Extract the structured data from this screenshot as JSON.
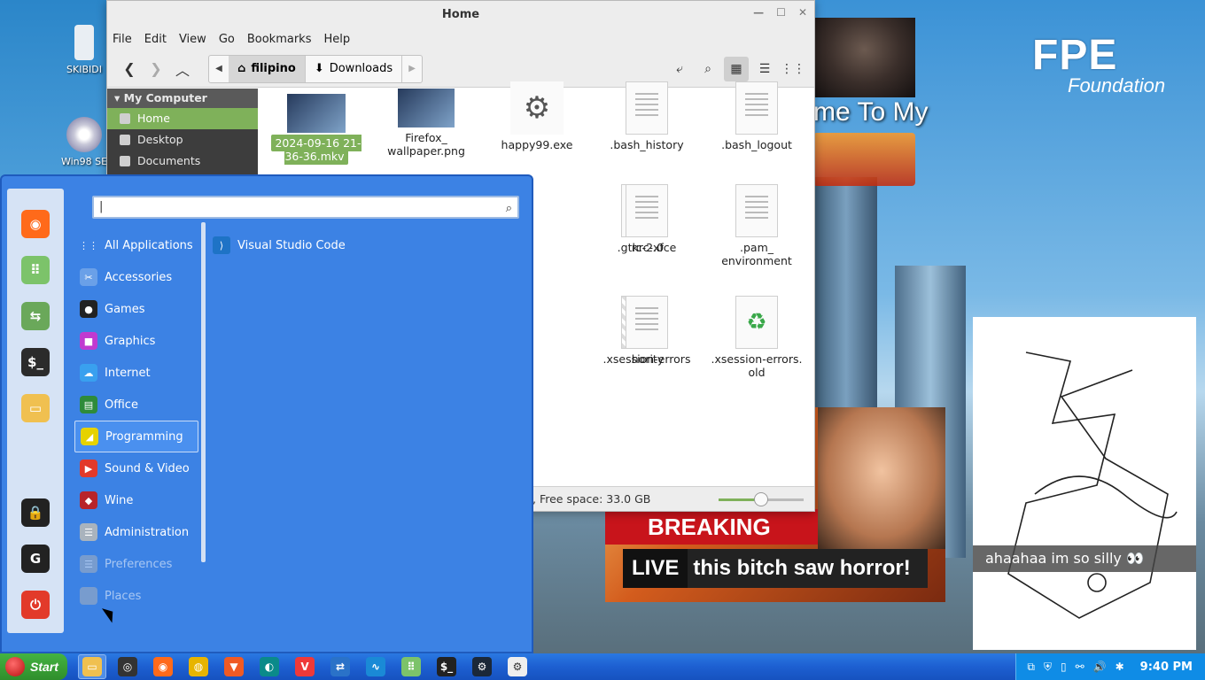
{
  "desktop": {
    "icons": [
      {
        "label": "SKIBIDI"
      },
      {
        "label": "Win98 SE"
      }
    ],
    "fpe": {
      "big": "FPE",
      "small": "Foundation"
    },
    "welcome_text": "me To My",
    "news": {
      "banner": "BREAKING NEWS",
      "live": "LIVE",
      "caption": "this bitch saw horror!"
    },
    "silly_caption": "ahaahaa im so silly 👀"
  },
  "file_manager": {
    "title": "Home",
    "menu": [
      "File",
      "Edit",
      "View",
      "Go",
      "Bookmarks",
      "Help"
    ],
    "breadcrumbs": [
      {
        "label": "filipino",
        "icon": "home-icon",
        "active": true
      },
      {
        "label": "Downloads",
        "icon": "download-icon",
        "active": false
      }
    ],
    "sidebar": {
      "heading": "My Computer",
      "items": [
        {
          "label": "Home",
          "selected": true
        },
        {
          "label": "Desktop",
          "selected": false
        },
        {
          "label": "Documents",
          "selected": false
        }
      ]
    },
    "files": [
      {
        "name": "2024-09-16 21-36-36.mkv",
        "type": "video",
        "selected": true
      },
      {
        "name": "Firefox_ wallpaper.png",
        "type": "image"
      },
      {
        "name": "happy99.exe",
        "type": "exe"
      },
      {
        "name": ".bash_history",
        "type": "doc"
      },
      {
        "name": ".bash_logout",
        "type": "doc"
      },
      {
        "name": "rc-2.0",
        "type": "doc"
      },
      {
        "name": ".gtkrc-xfce",
        "type": "doc"
      },
      {
        "name": ".pam_ environment",
        "type": "doc"
      },
      {
        "name": "hority",
        "type": "doc"
      },
      {
        "name": ".xsession-errors",
        "type": "doc"
      },
      {
        "name": ".xsession-errors. old",
        "type": "recycle"
      }
    ],
    "status": ", Free space: 33.0 GB",
    "zoom_level": 0.5
  },
  "start_menu": {
    "search_value": "|",
    "favorites": [
      {
        "icon": "firefox-icon",
        "color": "#ff6a1a"
      },
      {
        "icon": "app-grid-icon",
        "color": "#7cc36a"
      },
      {
        "icon": "toggle-icon",
        "color": "#6aa85a"
      },
      {
        "icon": "terminal-icon",
        "color": "#2b2b2b"
      },
      {
        "icon": "folder-icon",
        "color": "#f0c050"
      },
      {
        "icon": "lock-icon",
        "color": "#222222"
      },
      {
        "icon": "logout-icon",
        "color": "#222222"
      },
      {
        "icon": "power-icon",
        "color": "#e23a2a"
      }
    ],
    "categories": [
      {
        "label": "All Applications",
        "color": "#3c82e4",
        "glyph": "⋮⋮"
      },
      {
        "label": "Accessories",
        "color": "#6aa0e8",
        "glyph": "✂"
      },
      {
        "label": "Games",
        "color": "#222222",
        "glyph": "●"
      },
      {
        "label": "Graphics",
        "color": "#c03ad0",
        "glyph": "■"
      },
      {
        "label": "Internet",
        "color": "#39a0ef",
        "glyph": "☁"
      },
      {
        "label": "Office",
        "color": "#2e8b3a",
        "glyph": "▤"
      },
      {
        "label": "Programming",
        "color": "#e6d200",
        "glyph": "◢",
        "hover": true
      },
      {
        "label": "Sound & Video",
        "color": "#e23a2a",
        "glyph": "▶"
      },
      {
        "label": "Wine",
        "color": "#b8242a",
        "glyph": "◆"
      },
      {
        "label": "Administration",
        "color": "#a9b3bd",
        "glyph": "☰"
      },
      {
        "label": "Preferences",
        "color": "#a9b3bd",
        "glyph": "☰",
        "dim": true
      },
      {
        "label": "Places",
        "color": "#a9b3bd",
        "glyph": "",
        "dim": true
      }
    ],
    "apps": [
      {
        "label": "Visual Studio Code"
      }
    ]
  },
  "taskbar": {
    "start_label": "Start",
    "apps": [
      {
        "icon": "folder-icon",
        "active": true
      },
      {
        "icon": "aperture-icon"
      },
      {
        "icon": "firefox-icon"
      },
      {
        "icon": "chrome-icon"
      },
      {
        "icon": "brave-icon"
      },
      {
        "icon": "edge-dev-icon",
        "badge": "DEV"
      },
      {
        "icon": "vivaldi-icon"
      },
      {
        "icon": "remote-icon"
      },
      {
        "icon": "monitor-icon"
      },
      {
        "icon": "app-grid-icon"
      },
      {
        "icon": "terminal-icon"
      },
      {
        "icon": "steam-icon"
      },
      {
        "icon": "settings-icon"
      }
    ],
    "clock": "9:40 PM"
  }
}
